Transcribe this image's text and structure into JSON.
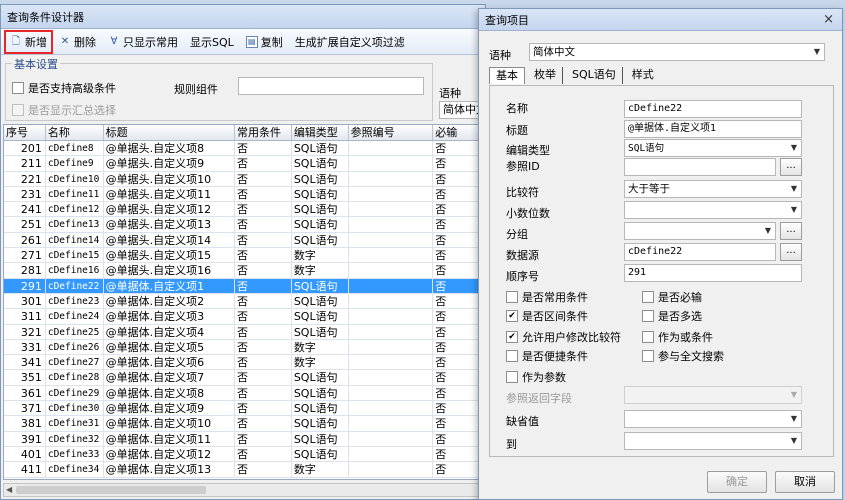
{
  "main_window": {
    "title": "查询条件设计器",
    "toolbar": [
      {
        "name": "new-button",
        "icon": "new-doc-icon",
        "glyph": "🗋",
        "label": "新增",
        "highlight": true
      },
      {
        "name": "delete-button",
        "icon": "delete-x-icon",
        "glyph": "✕",
        "label": "删除"
      },
      {
        "name": "show-common-button",
        "icon": "filter-icon",
        "glyph": "∀",
        "label": "只显示常用"
      },
      {
        "name": "show-sql-button",
        "icon": "",
        "glyph": "",
        "label": "显示SQL"
      },
      {
        "name": "copy-button",
        "icon": "copy-icon",
        "glyph": "▤",
        "label": "复制"
      },
      {
        "name": "generate-custom-button",
        "icon": "",
        "glyph": "",
        "label": "生成扩展自定义项过滤"
      }
    ],
    "basic_settings": {
      "legend": "基本设置",
      "support_advanced": "是否支持高级条件",
      "rule_group": "规则组件",
      "show_summary": "是否显示汇总选择"
    },
    "language_label": "语种",
    "language_value": "简体中文",
    "grid": {
      "columns": [
        "序号",
        "名称",
        "标题",
        "常用条件",
        "编辑类型",
        "参照编号",
        "必输"
      ],
      "selected_index": 9,
      "rows": [
        [
          "201",
          "cDefine8",
          "@单据头.自定义项8",
          "否",
          "SQL语句",
          "",
          "否"
        ],
        [
          "211",
          "cDefine9",
          "@单据头.自定义项9",
          "否",
          "SQL语句",
          "",
          "否"
        ],
        [
          "221",
          "cDefine10",
          "@单据头.自定义项10",
          "否",
          "SQL语句",
          "",
          "否"
        ],
        [
          "231",
          "cDefine11",
          "@单据头.自定义项11",
          "否",
          "SQL语句",
          "",
          "否"
        ],
        [
          "241",
          "cDefine12",
          "@单据头.自定义项12",
          "否",
          "SQL语句",
          "",
          "否"
        ],
        [
          "251",
          "cDefine13",
          "@单据头.自定义项13",
          "否",
          "SQL语句",
          "",
          "否"
        ],
        [
          "261",
          "cDefine14",
          "@单据头.自定义项14",
          "否",
          "SQL语句",
          "",
          "否"
        ],
        [
          "271",
          "cDefine15",
          "@单据头.自定义项15",
          "否",
          "数字",
          "",
          "否"
        ],
        [
          "281",
          "cDefine16",
          "@单据头.自定义项16",
          "否",
          "数字",
          "",
          "否"
        ],
        [
          "291",
          "cDefine22",
          "@单据体.自定义项1",
          "否",
          "SQL语句",
          "",
          "否"
        ],
        [
          "301",
          "cDefine23",
          "@单据体.自定义项2",
          "否",
          "SQL语句",
          "",
          "否"
        ],
        [
          "311",
          "cDefine24",
          "@单据体.自定义项3",
          "否",
          "SQL语句",
          "",
          "否"
        ],
        [
          "321",
          "cDefine25",
          "@单据体.自定义项4",
          "否",
          "SQL语句",
          "",
          "否"
        ],
        [
          "331",
          "cDefine26",
          "@单据体.自定义项5",
          "否",
          "数字",
          "",
          "否"
        ],
        [
          "341",
          "cDefine27",
          "@单据体.自定义项6",
          "否",
          "数字",
          "",
          "否"
        ],
        [
          "351",
          "cDefine28",
          "@单据体.自定义项7",
          "否",
          "SQL语句",
          "",
          "否"
        ],
        [
          "361",
          "cDefine29",
          "@单据体.自定义项8",
          "否",
          "SQL语句",
          "",
          "否"
        ],
        [
          "371",
          "cDefine30",
          "@单据体.自定义项9",
          "否",
          "SQL语句",
          "",
          "否"
        ],
        [
          "381",
          "cDefine31",
          "@单据体.自定义项10",
          "否",
          "SQL语句",
          "",
          "否"
        ],
        [
          "391",
          "cDefine32",
          "@单据体.自定义项11",
          "否",
          "SQL语句",
          "",
          "否"
        ],
        [
          "401",
          "cDefine33",
          "@单据体.自定义项12",
          "否",
          "SQL语句",
          "",
          "否"
        ],
        [
          "411",
          "cDefine34",
          "@单据体.自定义项13",
          "否",
          "数字",
          "",
          "否"
        ]
      ]
    }
  },
  "dialog": {
    "title": "查询项目",
    "close_glyph": "×",
    "language_label": "语种",
    "language_value": "简体中文",
    "tabs": [
      "基本",
      "枚举",
      "SQL语句",
      "样式"
    ],
    "labels": {
      "name": "名称",
      "title": "标题",
      "edit_type": "编辑类型",
      "ref_id": "参照ID",
      "compare": "比较符",
      "decimals": "小数位数",
      "group": "分组",
      "datasource": "数据源",
      "order": "顺序号",
      "ref_return": "参照返回字段",
      "default": "缺省值",
      "to": "到"
    },
    "values": {
      "name": "cDefine22",
      "title": "@单据体.自定义项1",
      "edit_type": "SQL语句",
      "compare": "大于等于",
      "datasource": "cDefine22",
      "order": "291"
    },
    "checkboxes": {
      "common": {
        "label": "是否常用条件",
        "checked": false
      },
      "required": {
        "label": "是否必输",
        "checked": false
      },
      "range": {
        "label": "是否区间条件",
        "checked": true
      },
      "multi": {
        "label": "是否多选",
        "checked": false
      },
      "user_modify": {
        "label": "允许用户修改比较符",
        "checked": true
      },
      "or_cond": {
        "label": "作为或条件",
        "checked": false
      },
      "convenient": {
        "label": "是否便捷条件",
        "checked": false
      },
      "fulltext": {
        "label": "参与全文搜索",
        "checked": false
      },
      "as_param": {
        "label": "作为参数",
        "checked": false
      }
    },
    "dots": "...",
    "check_glyph": "✔",
    "ok_label": "确定",
    "cancel_label": "取消"
  },
  "glyphs": {
    "arrow_down": "▼",
    "arrow_left": "◀",
    "arrow_right": "▶"
  }
}
